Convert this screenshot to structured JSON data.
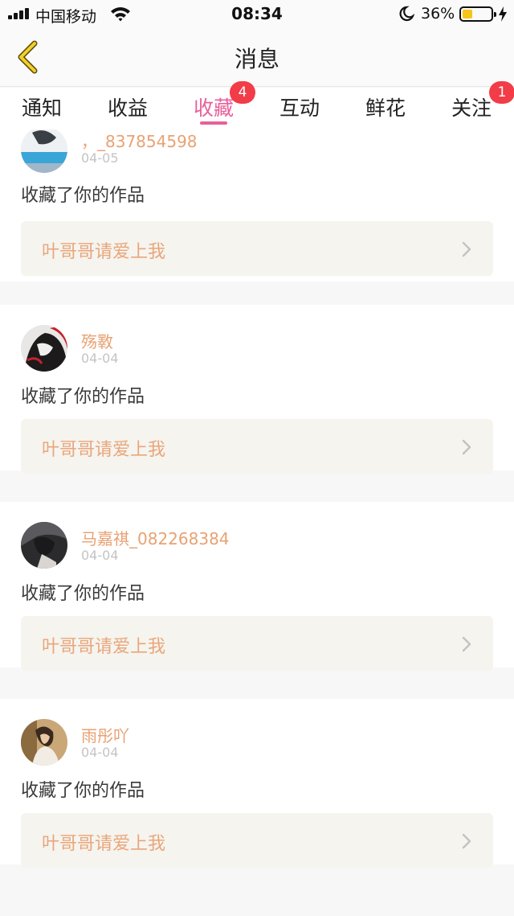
{
  "status_bar": {
    "carrier": "中国移动",
    "time": "08:34",
    "battery_percent": "36%",
    "battery_level": 0.36
  },
  "header": {
    "title": "消息"
  },
  "tabs": [
    {
      "label": "通知"
    },
    {
      "label": "收益"
    },
    {
      "label": "收藏",
      "badge": "4",
      "active": true
    },
    {
      "label": "互动"
    },
    {
      "label": "鲜花"
    },
    {
      "label": "关注",
      "badge": "1"
    }
  ],
  "notifications": [
    {
      "username": "，_837854598",
      "date": "04-05",
      "action": "收藏了你的作品",
      "work_title": "叶哥哥请爱上我"
    },
    {
      "username": "殇斁",
      "date": "04-04",
      "action": "收藏了你的作品",
      "work_title": "叶哥哥请爱上我"
    },
    {
      "username": "马嘉祺_082268384",
      "date": "04-04",
      "action": "收藏了你的作品",
      "work_title": "叶哥哥请爱上我"
    },
    {
      "username": "雨彤吖",
      "date": "04-04",
      "action": "收藏了你的作品",
      "work_title": "叶哥哥请爱上我"
    }
  ],
  "colors": {
    "accent": "#e8609a",
    "badge": "#f23c47",
    "username": "#e8a273",
    "work_title": "#eaa67a",
    "battery": "#f5c518"
  }
}
